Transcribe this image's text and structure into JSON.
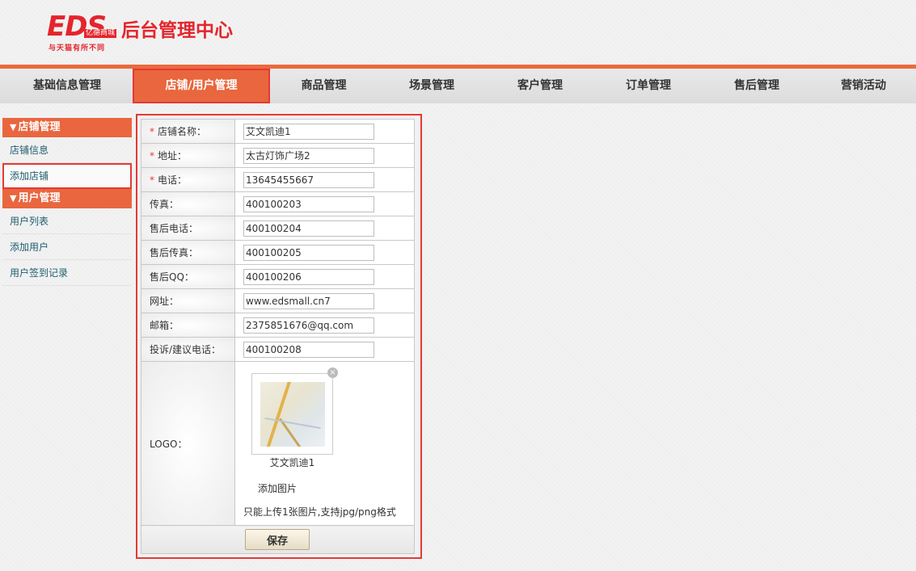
{
  "brand": {
    "logo_text": "EDS",
    "logo_sub": "亿德商城",
    "slogan": "与天猫有所不同",
    "title": "后台管理中心"
  },
  "nav": {
    "items": [
      {
        "label": "基础信息管理"
      },
      {
        "label": "店铺/用户管理"
      },
      {
        "label": "商品管理"
      },
      {
        "label": "场景管理"
      },
      {
        "label": "客户管理"
      },
      {
        "label": "订单管理"
      },
      {
        "label": "售后管理"
      },
      {
        "label": "营销活动"
      }
    ],
    "active_index": 1
  },
  "sidebar": {
    "groups": [
      {
        "title": "店铺管理",
        "items": [
          {
            "label": "店铺信息"
          },
          {
            "label": "添加店铺"
          }
        ]
      },
      {
        "title": "用户管理",
        "items": [
          {
            "label": "用户列表"
          },
          {
            "label": "添加用户"
          },
          {
            "label": "用户签到记录"
          }
        ]
      }
    ],
    "triangle": "▼",
    "selected": "添加店铺"
  },
  "form": {
    "fields": [
      {
        "label": "店铺名称：",
        "required": true,
        "value": "艾文凯迪1"
      },
      {
        "label": "地址：",
        "required": true,
        "value": "太古灯饰广场2"
      },
      {
        "label": "电话：",
        "required": true,
        "value": "13645455667"
      },
      {
        "label": "传真：",
        "required": false,
        "value": "400100203"
      },
      {
        "label": "售后电话：",
        "required": false,
        "value": "400100204"
      },
      {
        "label": "售后传真：",
        "required": false,
        "value": "400100205"
      },
      {
        "label": "售后QQ：",
        "required": false,
        "value": "400100206"
      },
      {
        "label": "网址：",
        "required": false,
        "value": "www.edsmall.cn7"
      },
      {
        "label": "邮箱：",
        "required": false,
        "value": "2375851676@qq.com"
      },
      {
        "label": "投诉/建议电话：",
        "required": false,
        "value": "400100208"
      }
    ],
    "required_mark": "*",
    "logo": {
      "label": "LOGO：",
      "caption": "艾文凯迪1",
      "add_label": "添加图片",
      "hint": "只能上传1张图片,支持jpg/png格式",
      "remove_glyph": "×"
    },
    "save_label": "保存"
  },
  "colors": {
    "accent": "#e9663e",
    "brand_red": "#e4252c",
    "highlight": "#e53935",
    "link": "#1f5d6e"
  }
}
